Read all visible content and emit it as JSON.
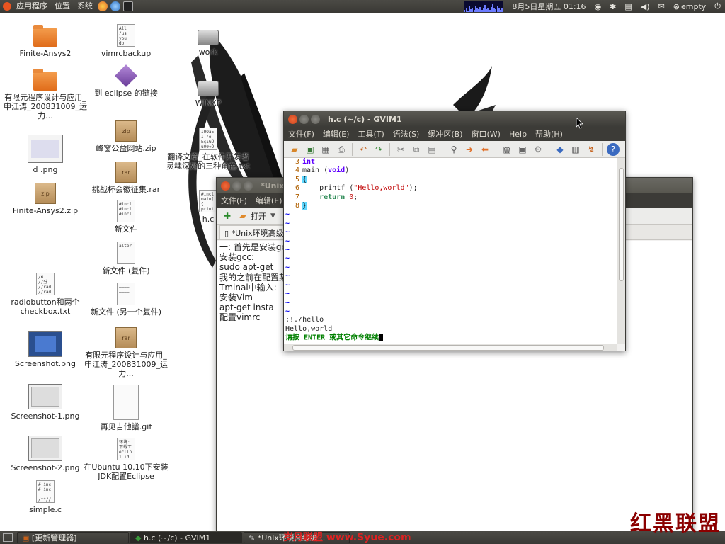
{
  "top_panel": {
    "menus": [
      "应用程序",
      "位置",
      "系统"
    ],
    "clock": "8月5日星期五 01:16",
    "user": "empty"
  },
  "desktop_icons": {
    "col1": [
      {
        "label": "Finite-Ansys2",
        "icon": "folder"
      },
      {
        "label": "有限元程序设计与应用_申江涛_200831009_运力...",
        "icon": "folder"
      },
      {
        "label": "d .png",
        "icon": "image"
      },
      {
        "label": "Finite-Ansys2.zip",
        "icon": "zip"
      },
      {
        "label": "radiobutton和两个checkbox.txt",
        "icon": "text"
      },
      {
        "label": "Screenshot.png",
        "icon": "image"
      },
      {
        "label": "Screenshot-1.png",
        "icon": "image"
      },
      {
        "label": "Screenshot-2.png",
        "icon": "image"
      },
      {
        "label": "simple.c",
        "icon": "text"
      }
    ],
    "col2": [
      {
        "label": "vimrcbackup",
        "icon": "text",
        "preview": "All\n/us\nyou\ndo"
      },
      {
        "label": "到 eclipse 的链接",
        "icon": "link"
      },
      {
        "label": "峰窗公益网站.zip",
        "icon": "zip"
      },
      {
        "label": "挑战杯会徽征集.rar",
        "icon": "rar"
      },
      {
        "label": "新文件",
        "icon": "text",
        "preview": "#incl\n#incl\n#incl"
      },
      {
        "label": "新文件 (复件)",
        "icon": "text",
        "preview": "alter"
      },
      {
        "label": "新文件 (另一个复件)",
        "icon": "text"
      },
      {
        "label": "有限元程序设计与应用_申江涛_200831009_运力...",
        "icon": "rar"
      },
      {
        "label": "再见吉他譜.gif",
        "icon": "image"
      },
      {
        "label": "在Ubuntu 10.10下安装JDK配置Eclipse",
        "icon": "text",
        "preview": "环境:\n下载工\neclip\n1 id"
      }
    ],
    "col3": [
      {
        "label": "work",
        "icon": "drive"
      },
      {
        "label": "WINXP",
        "icon": "drive"
      },
      {
        "label": "翻译文章_在软件开发者灵魂深处的三种角色.txt",
        "icon": "text",
        "preview": "IOOaE\nI'°o\nEçiGÜ\nu00«Ô"
      },
      {
        "label": "h.c",
        "icon": "text",
        "preview": "#incl\nmain(\n{\nprint"
      }
    ]
  },
  "gvim": {
    "title": "h.c (~/c) - GVIM1",
    "menus": [
      "文件(F)",
      "编辑(E)",
      "工具(T)",
      "语法(S)",
      "缓冲区(B)",
      "窗口(W)",
      "Help",
      "帮助(H)"
    ],
    "code": {
      "ln3": "3",
      "ln4": "4",
      "ln5": "5",
      "ln6": "6",
      "ln7": "7",
      "ln8": "8",
      "l3_type": "int",
      "l4_name": "main (",
      "l4_type": "void",
      "l4_close": ")",
      "l5_brace": "{",
      "l6_call": "printf (",
      "l6_str": "\"Hello,world\"",
      "l6_end": ");",
      "l7_kw": "return",
      "l7_num": "0",
      "l7_end": ";",
      "l8_brace": "}"
    },
    "tilde": "~",
    "cmd": ":!./hello",
    "output": "Hello,world",
    "prompt": "请按 ENTER 或其它命令继续"
  },
  "gedit": {
    "title": "*Unix环",
    "menus": [
      "文件(F)",
      "编辑(E)"
    ],
    "open_label": "打开",
    "tab_label": "*Unix环境高级编",
    "lines": [
      "一: 首先是安装gc",
      "安装gcc:",
      "sudo apt-get",
      "我的之前在配置某",
      "Tminal中输入:",
      "安装Vim",
      "apt-get insta",
      "配置vimrc"
    ]
  },
  "taskbar": {
    "items": [
      "[更新管理器]",
      "h.c (~/c) - GVIM1",
      "*Unix环境高级编..."
    ]
  },
  "watermark": {
    "logo": "红黑联盟",
    "site": "岁月联盟  www.Syue.com"
  }
}
